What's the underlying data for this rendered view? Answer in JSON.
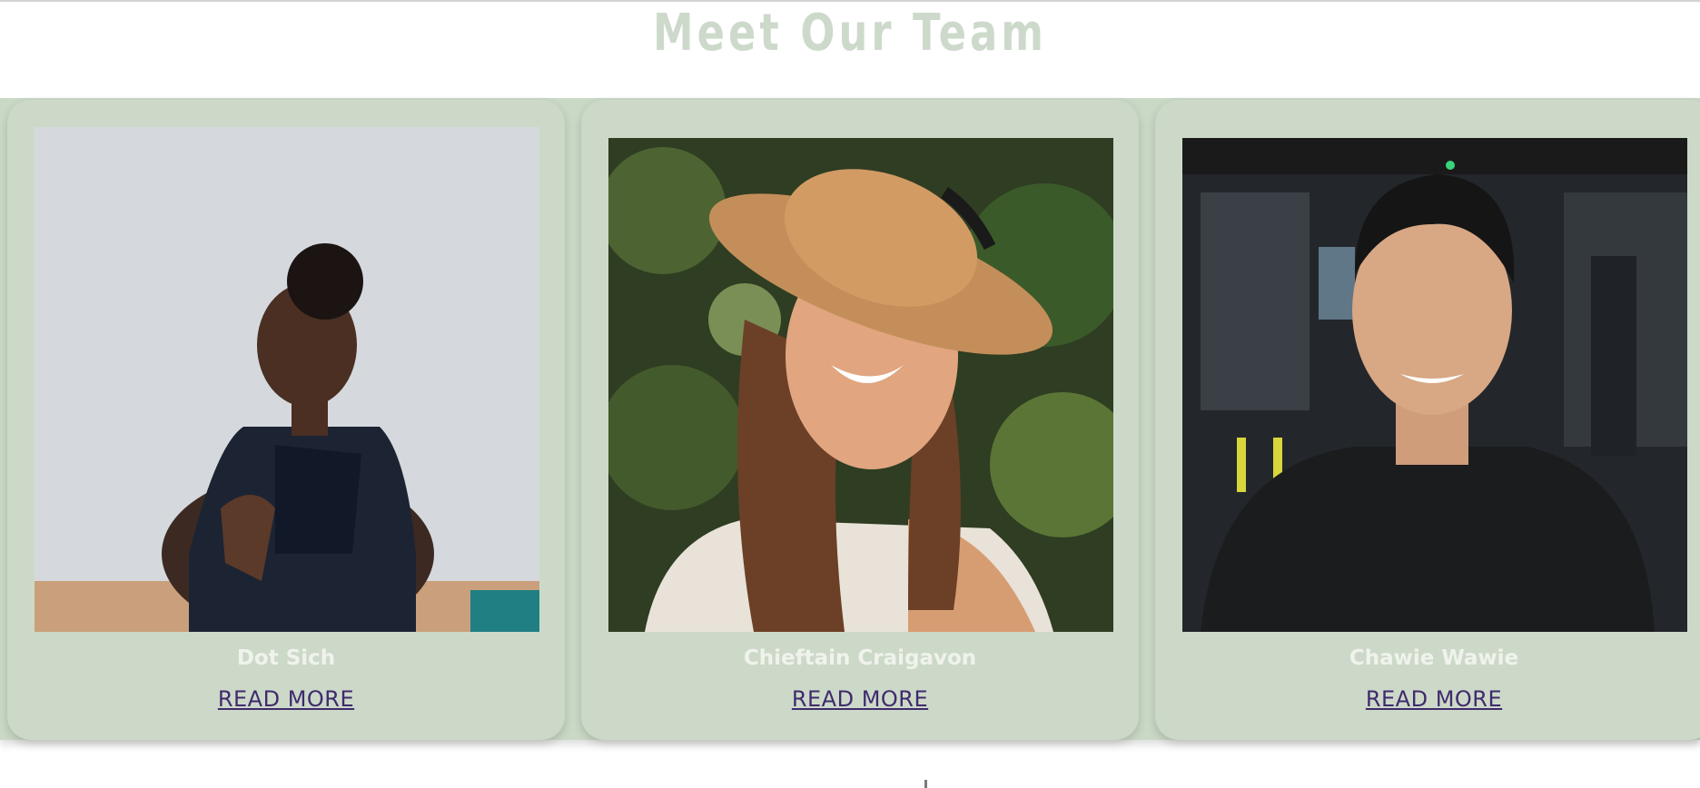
{
  "section": {
    "title": "Meet Our Team"
  },
  "team": [
    {
      "name": "Dot Sich",
      "link_label": "READ MORE"
    },
    {
      "name": "Chieftain Craigavon",
      "link_label": "READ MORE"
    },
    {
      "name": "Chawie Wawie",
      "link_label": "READ MORE"
    }
  ],
  "colors": {
    "title": "#cddacb",
    "card_background": "#cdd9c8",
    "name_text": "#eff3ec",
    "link_text": "#3f2b6e"
  }
}
